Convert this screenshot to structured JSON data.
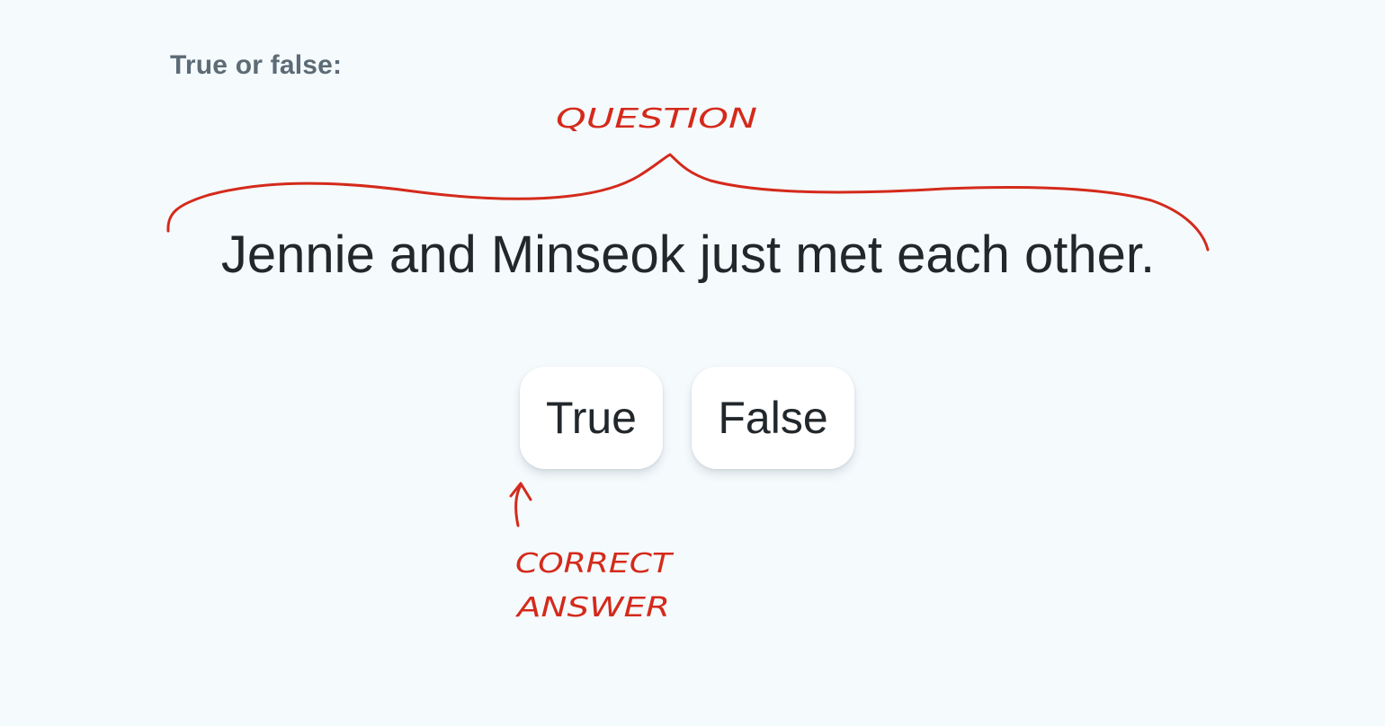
{
  "prompt": {
    "label": "True or false:"
  },
  "question": {
    "text": "Jennie and Minseok just met each other."
  },
  "answers": [
    {
      "label": "True"
    },
    {
      "label": "False"
    }
  ],
  "annotations": {
    "question_label": "QUESTION",
    "correct_line1": "CORRECT",
    "correct_line2": "ANSWER",
    "color": "#d42a1b"
  },
  "colors": {
    "background": "#f5fafd",
    "prompt_text": "#5c6b75",
    "body_text": "#22272b",
    "button_bg": "#ffffff"
  }
}
